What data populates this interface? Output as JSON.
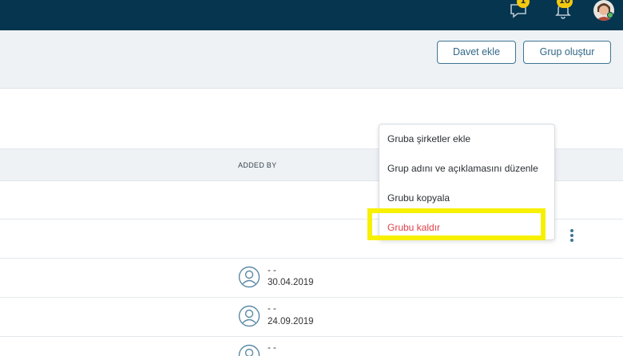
{
  "topbar": {
    "messages_badge": "1",
    "notifications_badge": "10"
  },
  "actions": {
    "invite_label": "Davet ekle",
    "create_group_label": "Grup oluştur"
  },
  "table": {
    "columns": [
      "ADDED BY"
    ],
    "rows": [
      {
        "added_by": "- -",
        "date": "30.04.2019"
      },
      {
        "added_by": "- -",
        "date": "24.09.2019"
      },
      {
        "added_by": "- -",
        "date": ""
      }
    ]
  },
  "menu": {
    "items": [
      {
        "label": "Gruba şirketler ekle"
      },
      {
        "label": "Grup adını ve açıklamasını düzenle"
      },
      {
        "label": "Grubu kopyala"
      },
      {
        "label": "Grubu kaldır"
      }
    ]
  },
  "colors": {
    "nav_bg": "#05354f",
    "accent": "#3f7592",
    "badge": "#f3c80f",
    "danger": "#e0404a",
    "highlight": "#f7f000"
  }
}
